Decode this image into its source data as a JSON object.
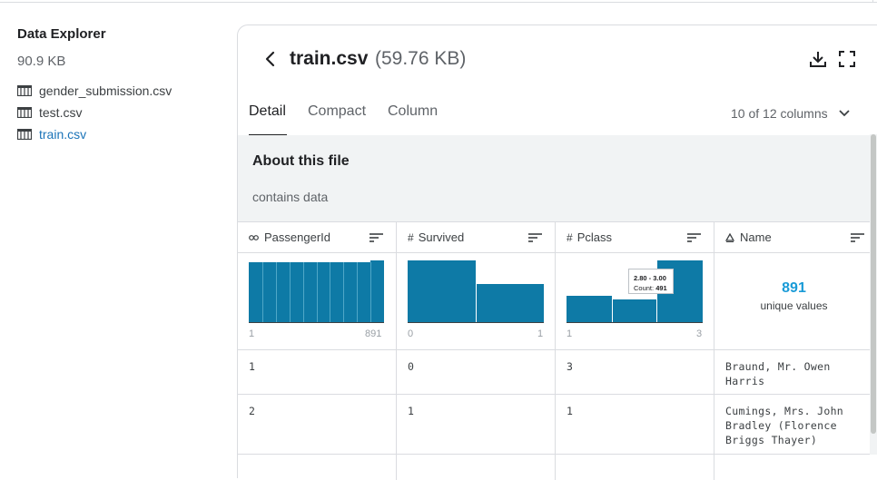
{
  "explorer": {
    "title": "Data Explorer",
    "size": "90.9 KB",
    "files": [
      {
        "name": "gender_submission.csv",
        "active": false
      },
      {
        "name": "test.csv",
        "active": false
      },
      {
        "name": "train.csv",
        "active": true
      }
    ]
  },
  "file": {
    "title": "train.csv",
    "size": "(59.76 KB)"
  },
  "tabs": [
    "Detail",
    "Compact",
    "Column"
  ],
  "active_tab": "Detail",
  "column_selector": "10 of 12 columns",
  "about": {
    "title": "About this file",
    "text": "contains data"
  },
  "columns": [
    {
      "name": "PassengerId",
      "type_icon": "id-icon",
      "min": "1",
      "max": "891"
    },
    {
      "name": "Survived",
      "type_icon": "#",
      "min": "0",
      "max": "1"
    },
    {
      "name": "Pclass",
      "type_icon": "#",
      "min": "1",
      "max": "3",
      "tooltip": {
        "range": "2.80 - 3.00",
        "count_label": "Count:",
        "count": "491"
      }
    },
    {
      "name": "Name",
      "type_icon": "string-icon",
      "unique_count": "891",
      "unique_label": "unique values"
    }
  ],
  "rows": [
    [
      "1",
      "0",
      "3",
      "Braund, Mr. Owen Harris"
    ],
    [
      "2",
      "1",
      "1",
      "Cumings, Mrs. John Bradley (Florence Briggs Thayer)"
    ]
  ],
  "colors": {
    "bar": "#0e7aa6",
    "link": "#1a73b8",
    "unique": "#1a9bd7"
  }
}
